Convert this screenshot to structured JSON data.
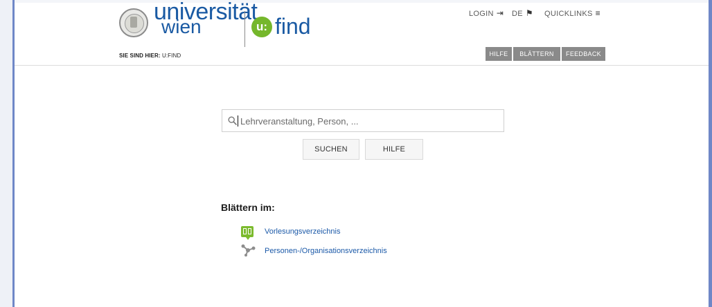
{
  "header": {
    "logo_line1": "universität",
    "logo_line2": "wien",
    "app_badge": "u:",
    "app_name": "find",
    "breadcrumb_prefix": "SIE SIND HIER:",
    "breadcrumb_page": "U:FIND",
    "topnav": {
      "login": "LOGIN",
      "login_icon": "login-arrow-icon",
      "language": "DE",
      "language_icon": "flag-icon",
      "quicklinks": "QUICKLINKS",
      "quicklinks_icon": "menu-lines-icon"
    },
    "buttons": {
      "help": "HILFE",
      "browse": "BLÄTTERN",
      "feedback": "FEEDBACK"
    }
  },
  "search": {
    "placeholder": "Lehrveranstaltung, Person, ...",
    "value": "",
    "submit_label": "SUCHEN",
    "help_label": "HILFE"
  },
  "browse": {
    "title": "Blättern im:",
    "items": [
      {
        "label": "Vorlesungsverzeichnis",
        "icon": "book-icon"
      },
      {
        "label": "Personen-/Organisationsverzeichnis",
        "icon": "network-icon"
      }
    ]
  },
  "colors": {
    "brand_blue": "#1a5aa3",
    "brand_green": "#75b72b",
    "link_blue": "#1b59a8",
    "grey_button": "#8a8a8a"
  }
}
